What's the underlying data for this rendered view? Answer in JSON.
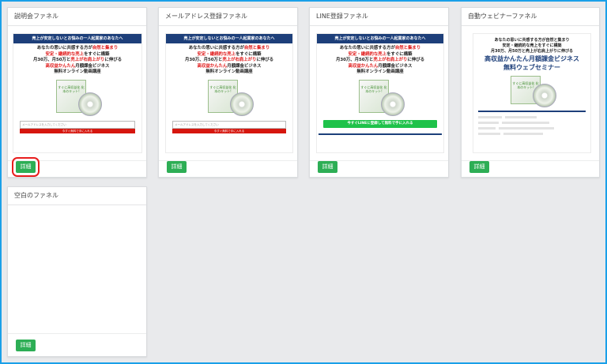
{
  "cards": [
    {
      "title": "説明会ファネル",
      "thumb": {
        "banner": "売上が安定しないとお悩みの一人起業家のあなたへ",
        "line1": "あなたの思いに共感する方が",
        "line1_red": "自然と集まり",
        "line2_red": "安定・継続的な売上",
        "line2": "をすぐに構築",
        "line3": "月30万、月50万と",
        "line3_red": "売上が右肩上がり",
        "line3b": "に伸びる",
        "line4_red": "高収益かんたん",
        "line4": "月額課金ビジネス",
        "line5": "無料オンライン動画講座",
        "box_text": "すぐに高収益化 化本のキット!",
        "input_placeholder": "メールアドレスを入力してください",
        "cta": "今すぐ無料で手に入れる"
      },
      "button": "詳細"
    },
    {
      "title": "メールアドレス登録ファネル",
      "thumb": {
        "banner": "売上が安定しないとお悩みの一人起業家のあなたへ",
        "line1": "あなたの思いに共感する方が",
        "line1_red": "自然と集まり",
        "line2_red": "安定・継続的な売上",
        "line2": "をすぐに構築",
        "line3": "月30万、月50万と",
        "line3_red": "売上が右肩上がり",
        "line3b": "に伸びる",
        "line4_red": "高収益かんたん",
        "line4": "月額課金ビジネス",
        "line5": "無料オンライン動画講座",
        "box_text": "すぐに高収益化 化本のキット!",
        "input_placeholder": "メールアドレスを入力してください",
        "cta": "今すぐ無料で手に入れる"
      },
      "button": "詳細"
    },
    {
      "title": "LINE登録ファネル",
      "thumb": {
        "banner": "売上が安定しないとお悩みの一人起業家のあなたへ",
        "line1": "あなたの思いに共感する方が",
        "line1_red": "自然と集まり",
        "line2_red": "安定・継続的な売上",
        "line2": "をすぐに構築",
        "line3": "月30万、月50万と",
        "line3_red": "売上が右肩上がり",
        "line3b": "に伸びる",
        "line4_red": "高収益かんたん",
        "line4": "月額課金ビジネス",
        "line5": "無料オンライン動画講座",
        "box_text": "すぐに高収益化 化本のキット!",
        "cta": "今すぐLINEに登録して無料で手に入れる"
      },
      "button": "詳細"
    },
    {
      "title": "自動ウェビナーファネル",
      "thumb": {
        "head1": "あなたの思いに共感する方が自然と集まり",
        "head2": "安定・継続的な売上をすぐに構築",
        "head3": "月30万、月50万と売上が右肩上がりに伸びる",
        "big1": "高収益かんたん月額課金ビジネス",
        "big2": "無料ウェブセミナー",
        "box_text": "すぐに高収益化 化本のキット!"
      },
      "button": "詳細"
    },
    {
      "title": "空白のファネル",
      "button": "詳細"
    }
  ]
}
